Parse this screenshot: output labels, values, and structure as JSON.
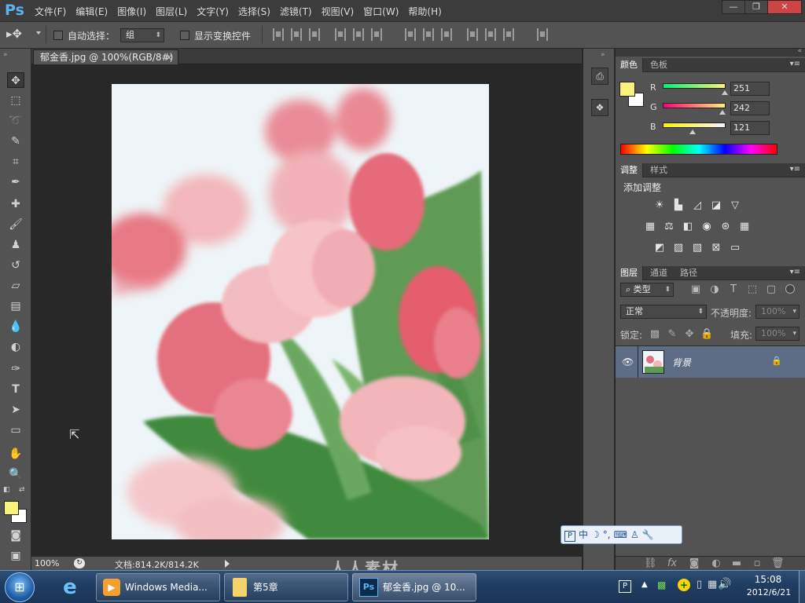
{
  "menubar": {
    "logo": "Ps",
    "menus": [
      "文件(F)",
      "编辑(E)",
      "图像(I)",
      "图层(L)",
      "文字(Y)",
      "选择(S)",
      "滤镜(T)",
      "视图(V)",
      "窗口(W)",
      "帮助(H)"
    ],
    "win_min": "—",
    "win_max": "❐",
    "win_close": "✕"
  },
  "options": {
    "auto_select_label": "自动选择：",
    "auto_select_value": "组",
    "show_transform_label": "显示变换控件"
  },
  "document": {
    "tab_label": "郁金香.jpg @ 100%(RGB/8#)",
    "tab_close": "×",
    "zoom": "100%",
    "doc_info": "文档:814.2K/814.2K"
  },
  "color_panel": {
    "tabs": [
      "颜色",
      "色板"
    ],
    "r_label": "R",
    "g_label": "G",
    "b_label": "B",
    "r": 251,
    "g": 242,
    "b": 121,
    "fg_color": "#fbf279",
    "bg_color": "#ffffff"
  },
  "adjust_panel": {
    "tabs": [
      "调整",
      "样式"
    ],
    "title": "添加调整"
  },
  "layers_panel": {
    "tabs": [
      "图层",
      "通道",
      "路径"
    ],
    "kind_label": "类型",
    "blend_mode": "正常",
    "opacity_label": "不透明度:",
    "opacity_value": "100%",
    "lock_label": "锁定:",
    "fill_label": "填充:",
    "fill_value": "100%",
    "layer_name": "背景"
  },
  "ime": {
    "mode": "中"
  },
  "taskbar": {
    "items": [
      "Windows Media...",
      "第5章",
      "郁金香.jpg @ 10..."
    ],
    "time": "15:08",
    "date": "2012/6/21"
  },
  "watermark": "人人素材"
}
